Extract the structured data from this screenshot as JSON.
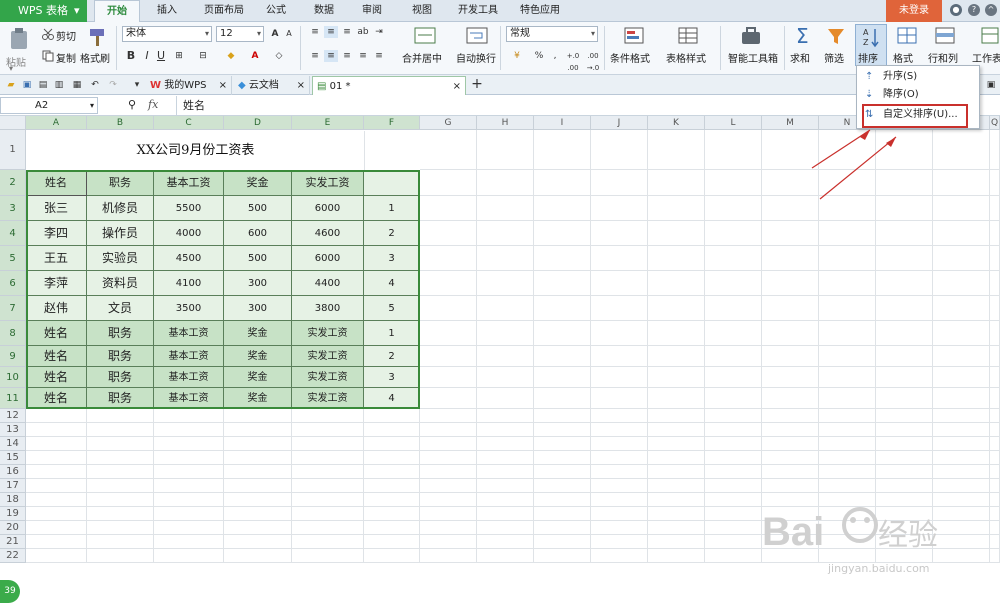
{
  "app": {
    "title": "WPS 表格",
    "menu_tabs": [
      "开始",
      "插入",
      "页面布局",
      "公式",
      "数据",
      "审阅",
      "视图",
      "开发工具",
      "特色应用"
    ],
    "active_tab": "开始",
    "login": "未登录"
  },
  "ribbon": {
    "paste": "粘贴",
    "cut": "剪切",
    "copy": "复制",
    "format_painter": "格式刷",
    "font_name": "宋体",
    "font_size": "12",
    "merge_center": "合并居中",
    "wrap_text": "自动换行",
    "number_format": "常规",
    "conditional_format": "条件格式",
    "table_style": "表格样式",
    "smart_toolbox": "智能工具箱",
    "sum": "求和",
    "filter": "筛选",
    "sort": "排序",
    "format": "格式",
    "row_col": "行和列",
    "worksheet": "工作表",
    "percent": "%",
    "comma": ",",
    "dec_inc": "+.0 .00",
    "dec_dec": ".00 →.0"
  },
  "doc_tabs": [
    {
      "label": "我的WPS"
    },
    {
      "label": "云文档"
    },
    {
      "label": "01 *"
    }
  ],
  "formula_bar": {
    "name_box": "A2",
    "fx": "fx",
    "value": "姓名"
  },
  "columns": [
    "A",
    "B",
    "C",
    "D",
    "E",
    "F",
    "G",
    "H",
    "I",
    "J",
    "K",
    "L",
    "M",
    "N",
    "O",
    "P",
    "Q"
  ],
  "rows": [
    "1",
    "2",
    "3",
    "4",
    "5",
    "6",
    "7",
    "8",
    "9",
    "10",
    "11",
    "12",
    "13",
    "14",
    "15",
    "16",
    "17",
    "18",
    "19",
    "20",
    "21",
    "22"
  ],
  "sheet": {
    "title": "XX公司9月份工资表",
    "header": [
      "姓名",
      "职务",
      "基本工资",
      "奖金",
      "实发工资"
    ],
    "body": [
      [
        "张三",
        "机修员",
        "5500",
        "500",
        "6000",
        "1"
      ],
      [
        "李四",
        "操作员",
        "4000",
        "600",
        "4600",
        "2"
      ],
      [
        "王五",
        "实验员",
        "4500",
        "500",
        "6000",
        "3"
      ],
      [
        "李萍",
        "资料员",
        "4100",
        "300",
        "4400",
        "4"
      ],
      [
        "赵伟",
        "文员",
        "3500",
        "300",
        "3800",
        "5"
      ],
      [
        "姓名",
        "职务",
        "基本工资",
        "奖金",
        "实发工资",
        "1"
      ],
      [
        "姓名",
        "职务",
        "基本工资",
        "奖金",
        "实发工资",
        "2"
      ],
      [
        "姓名",
        "职务",
        "基本工资",
        "奖金",
        "实发工资",
        "3"
      ],
      [
        "姓名",
        "职务",
        "基本工资",
        "奖金",
        "实发工资",
        "4"
      ]
    ]
  },
  "sort_menu": {
    "asc": "升序(S)",
    "desc": "降序(O)",
    "custom": "自定义排序(U)..."
  },
  "status": {
    "badge": "39"
  },
  "watermark": {
    "text": "Bai 经验",
    "url": "jingyan.baidu.com"
  },
  "colors": {
    "accent_green": "#33a54a",
    "login_orange": "#e0643a",
    "highlight_red": "#c9302c",
    "data_fill": "#e6f2e5"
  }
}
